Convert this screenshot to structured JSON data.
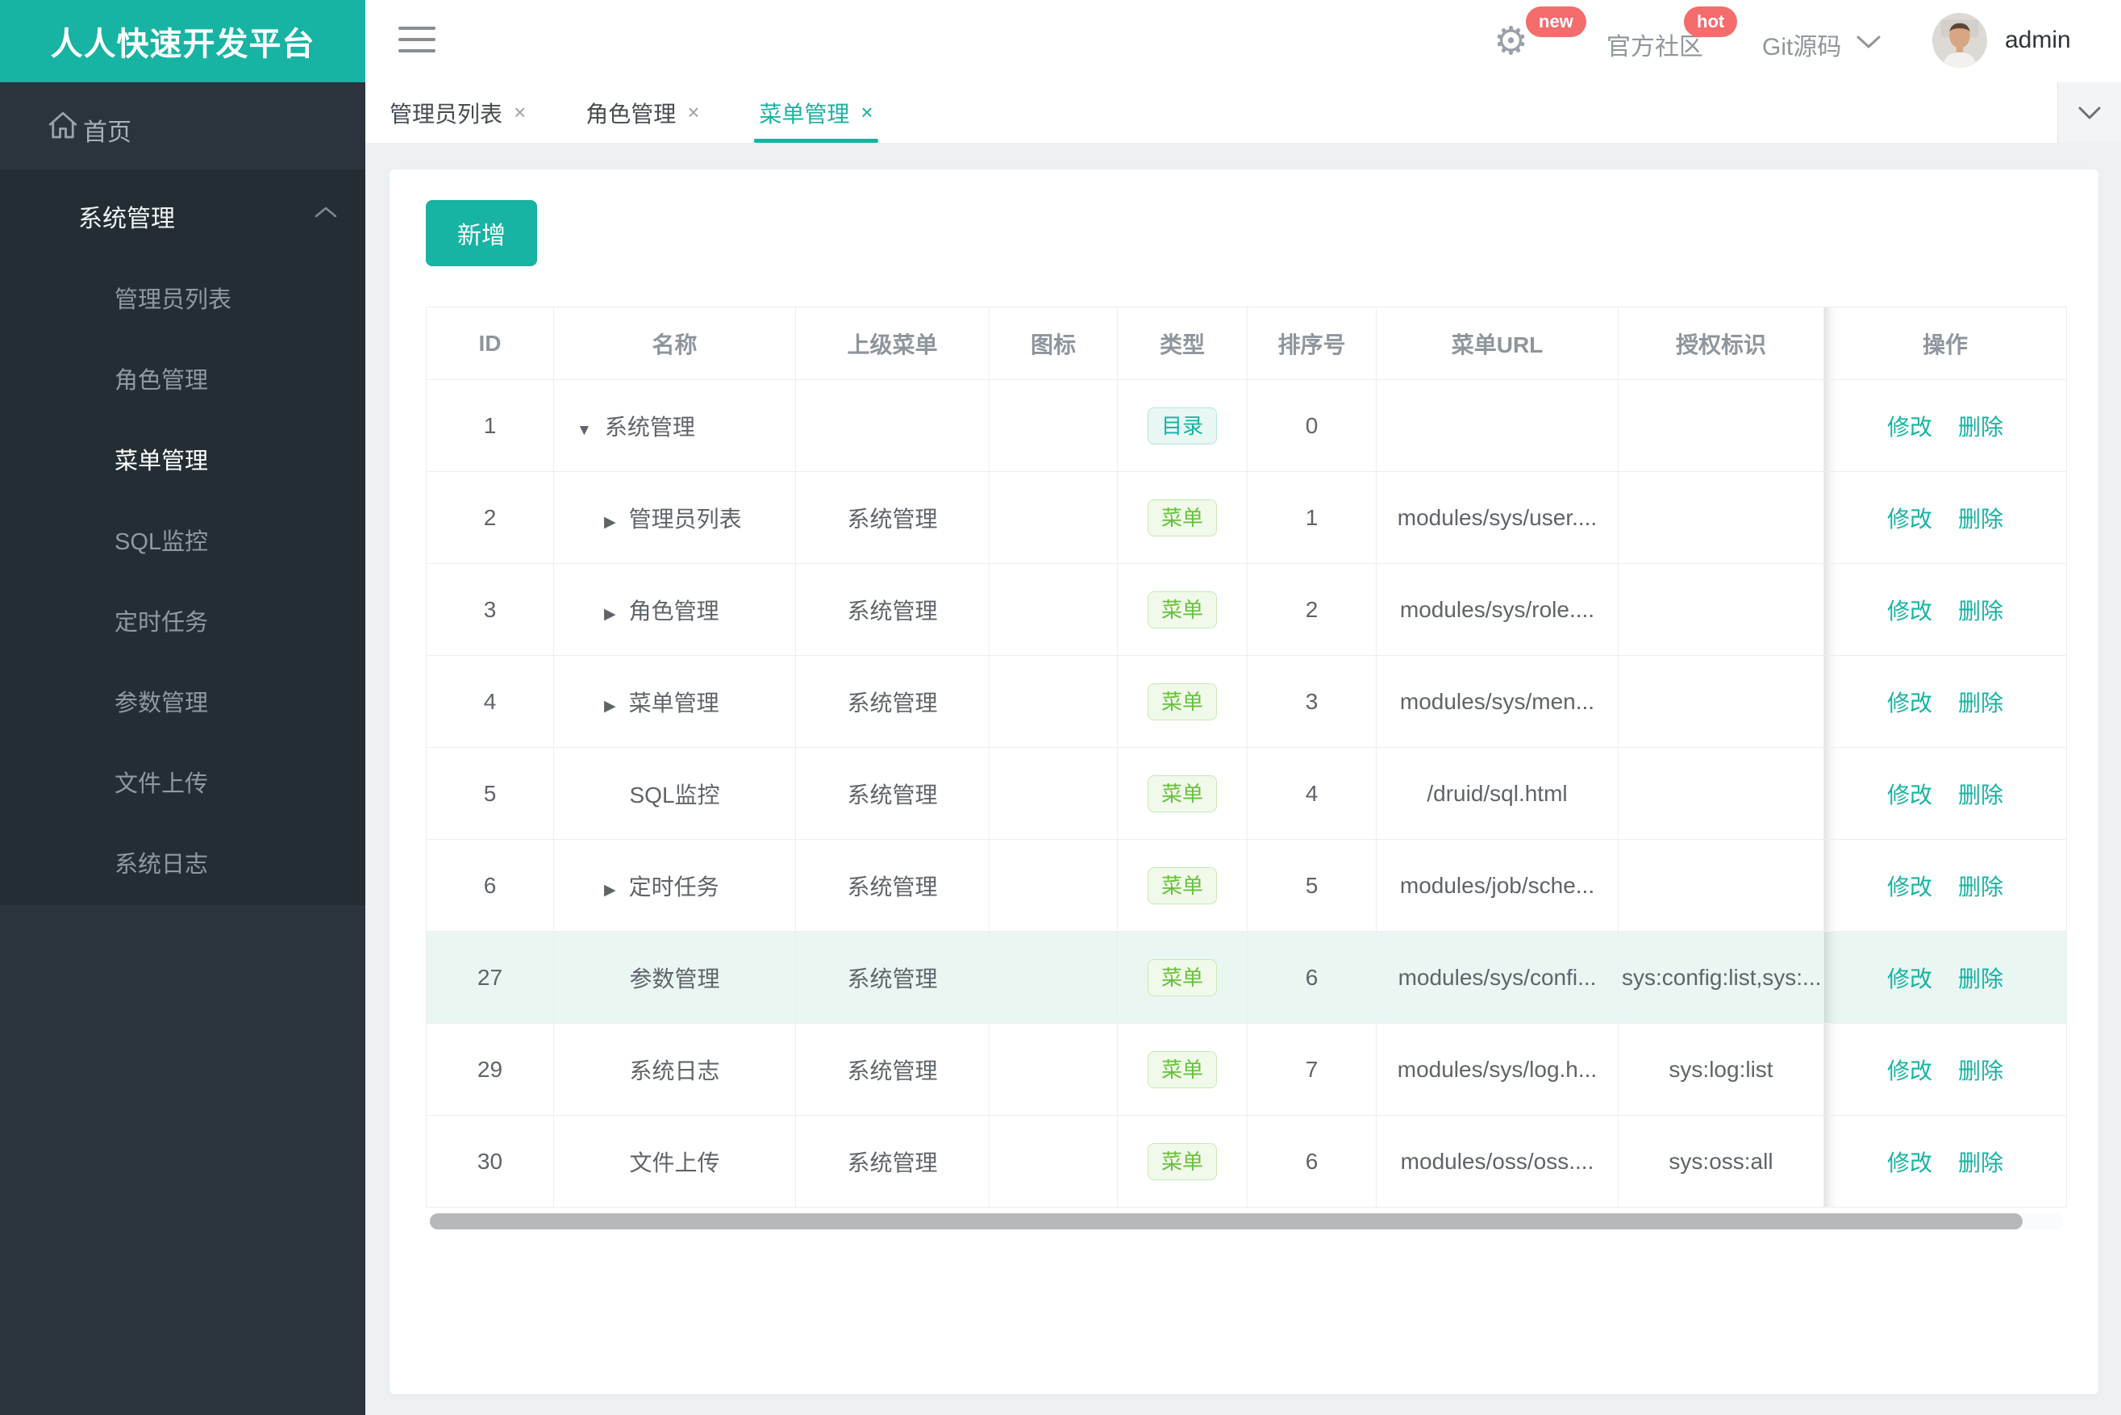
{
  "app": {
    "logo": "人人快速开发平台"
  },
  "theme": {
    "teal": "#17b3a3",
    "red": "#f56c6c",
    "green": "#67c23a",
    "highlight_row": "#eaf6f2",
    "sidebar": "#2b343c",
    "sidebar_submenu": "#242d33"
  },
  "header": {
    "community": "官方社区",
    "git": "Git源码",
    "user": "admin",
    "badge_new": "new",
    "badge_hot": "hot",
    "gear_glyph": "⚙"
  },
  "sidebar": {
    "home": "首页",
    "group": "系统管理",
    "items": [
      "管理员列表",
      "角色管理",
      "菜单管理",
      "SQL监控",
      "定时任务",
      "参数管理",
      "文件上传",
      "系统日志"
    ],
    "active_item": "菜单管理"
  },
  "tabs": {
    "close": "×",
    "items": [
      {
        "label": "管理员列表"
      },
      {
        "label": "角色管理"
      },
      {
        "label": "菜单管理",
        "active": true
      }
    ]
  },
  "toolbar": {
    "add_label": "新增"
  },
  "glyphs": {
    "down": "▼",
    "right": "▶"
  },
  "table": {
    "columns": [
      "ID",
      "名称",
      "上级菜单",
      "图标",
      "类型",
      "排序号",
      "菜单URL",
      "授权标识",
      "操作"
    ],
    "ops": {
      "edit": "修改",
      "delete": "删除"
    },
    "rows": [
      {
        "id": "1",
        "name": "系统管理",
        "arrow": "down",
        "parent": "",
        "type": "目录",
        "type_style": "dir",
        "order": "0",
        "url": "",
        "auth": "",
        "highlight": false
      },
      {
        "id": "2",
        "name": "管理员列表",
        "arrow": "right",
        "parent": "系统管理",
        "type": "菜单",
        "type_style": "menu",
        "order": "1",
        "url": "modules/sys/user....",
        "auth": "",
        "highlight": false
      },
      {
        "id": "3",
        "name": "角色管理",
        "arrow": "right",
        "parent": "系统管理",
        "type": "菜单",
        "type_style": "menu",
        "order": "2",
        "url": "modules/sys/role....",
        "auth": "",
        "highlight": false
      },
      {
        "id": "4",
        "name": "菜单管理",
        "arrow": "right",
        "parent": "系统管理",
        "type": "菜单",
        "type_style": "menu",
        "order": "3",
        "url": "modules/sys/men...",
        "auth": "",
        "highlight": false
      },
      {
        "id": "5",
        "name": "SQL监控",
        "arrow": "none",
        "parent": "系统管理",
        "type": "菜单",
        "type_style": "menu",
        "order": "4",
        "url": "/druid/sql.html",
        "auth": "",
        "highlight": false
      },
      {
        "id": "6",
        "name": "定时任务",
        "arrow": "right",
        "parent": "系统管理",
        "type": "菜单",
        "type_style": "menu",
        "order": "5",
        "url": "modules/job/sche...",
        "auth": "",
        "highlight": false
      },
      {
        "id": "27",
        "name": "参数管理",
        "arrow": "none",
        "parent": "系统管理",
        "type": "菜单",
        "type_style": "menu",
        "order": "6",
        "url": "modules/sys/confi...",
        "auth": "sys:config:list,sys:...",
        "highlight": true
      },
      {
        "id": "29",
        "name": "系统日志",
        "arrow": "none",
        "parent": "系统管理",
        "type": "菜单",
        "type_style": "menu",
        "order": "7",
        "url": "modules/sys/log.h...",
        "auth": "sys:log:list",
        "highlight": false
      },
      {
        "id": "30",
        "name": "文件上传",
        "arrow": "none",
        "parent": "系统管理",
        "type": "菜单",
        "type_style": "menu",
        "order": "6",
        "url": "modules/oss/oss....",
        "auth": "sys:oss:all",
        "highlight": false
      }
    ]
  }
}
